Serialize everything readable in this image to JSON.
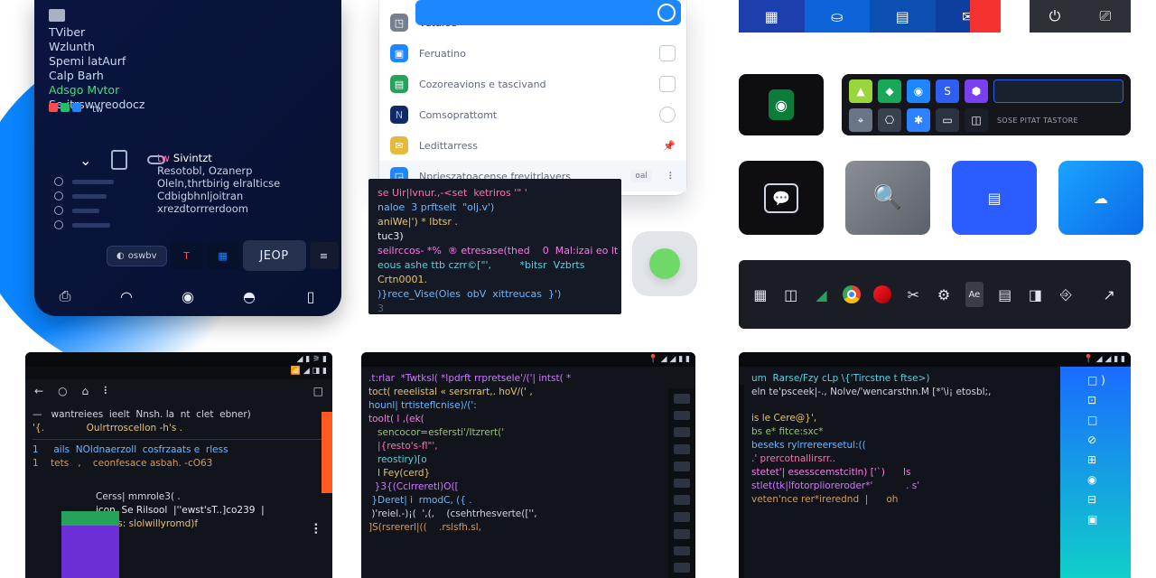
{
  "phone": {
    "links": [
      "TViber",
      "Wzlunth",
      "Spemi latAurf",
      "Calp Barh",
      "Adsgo Mvtor",
      "Se itrswvreodocz"
    ],
    "chips": [
      "#ff4a4a",
      "#21c065",
      "#1d87ff"
    ],
    "side": {
      "tag": "tw",
      "head": "Sivintzt",
      "l2": "Resotobl, Ozanerp",
      "l3": "Oleln,thrtbirig elralticse",
      "l4": "Cdbigbhnljoitran",
      "l5": "xrezdtorrrerdoom"
    },
    "pill": "oswbv",
    "big": "JEOP"
  },
  "dropdown": {
    "items": [
      {
        "c": "#74808f",
        "t": "Vutarse"
      },
      {
        "c": "#1d87ff",
        "t": "Feruatino"
      },
      {
        "c": "#25a35a",
        "t": "Cozoreavions e tascivand"
      },
      {
        "c": "#102a66",
        "t": "Comsoprattomt"
      },
      {
        "c": "#e7b93b",
        "t": "Ledittarress"
      },
      {
        "c": "#1d87ff",
        "t": "Nprieszatoacense frevitrlavers",
        "sel": true,
        "badge": "oal"
      }
    ]
  },
  "code": {
    "l1": "se Uir|lvnur.,-<set  ketriros '\" '",
    "l2": "naloe  3 prftselt  \"olj.v')",
    "l3": "aniWe|') * lbtsr .",
    "l4": "tuc3)",
    "l5": "seilrccos- *%  ® etresase(thed    0  Mal:izai eo lt",
    "l6": "eous ashe ttb czrr©[\"',         *bitsr  Vzbrts",
    "l7": "Crtn0001.",
    "l8": ")}rece_Vise(Oles  obV  xittreucas  }')",
    "l9": "3"
  },
  "tabs": [
    {
      "bg": "#1d3fae",
      "ic": "grid"
    },
    {
      "bg": "#0e63d8",
      "ic": "user"
    },
    {
      "bg": "#0b50b0",
      "ic": "doc"
    },
    {
      "bg": "#0e3fa0",
      "ic": "mail"
    }
  ],
  "grid": {
    "r1": [
      "#9ad63a",
      "#19a85a",
      "#1d87ff",
      "#2e5ff0",
      "#7a3ff0",
      "#18212e"
    ],
    "r2": [
      "#6a7586",
      "#384150",
      "#2d83ff",
      "#2b3240",
      "#1a1f29",
      "#20262f"
    ],
    "label": "SOSE PITAT TASTORE"
  },
  "tiles": [
    {
      "bg": "#0e0e11",
      "ic": "chat"
    },
    {
      "bg": "linear-gradient(135deg,#8a8f97,#5b6069)",
      "ic": "search"
    },
    {
      "bg": "#2a5cff",
      "ic": "lines"
    },
    {
      "bg": "linear-gradient(135deg,#1aa4ff,#0a6ae8)",
      "ic": "cloud"
    }
  ],
  "mob1": {
    "nav": [
      "←",
      "○",
      "⌂",
      "⠇",
      "□"
    ],
    "l1": "—   wantreiees  ieelt  Nnsh. la  nt  clet  ebner)",
    "l2": "'{.              Oulrtrroscellon -h's .",
    "l3": "1     ails  NOldnaerzoll  cosfrzaats e  rless",
    "l4": "1    tets   ,    ceonfesace asbah. -cO63",
    "l5": "Cerss| mmrole3( .",
    "l6": "icon  Se Rilsool  |''ewst'sT..]co239  |",
    "l7": "ffrees: slolwillyromd)f"
  },
  "mob2": {
    "l1": ".t:rlar  *Twtksl( *lpdrft rrpretsele'/('| intst( *",
    "l2": "toct( reeelistal « sersrrart,. hoV/(' ,",
    "l3": "hounl| trtisteflcnise)/(':",
    "l4": "toolt( l ,(ek(",
    "l5": "   sencocor=esfersti'/Itzrert('",
    "l6": "   |{resto's-fl\"',",
    "l7": "   reostiry)[o",
    "l8": "   l Fey(cerd}",
    "l9": "  }3{(Cclrreretl)O([",
    "l10": " }Deret| i  rmodC, ({ .",
    "l11": " )'reiel.-)¡(  ',(,    (csehtrhesverte(['',",
    "l12": "]S(rsrererl|((    .rslsfh.sl,",
    "side_n": 11
  },
  "mob3": {
    "l1": "um  Rarse/Fzy cLp \\{'Tircstne t ftse>)",
    "l2": "eln te'psceek|-., Nolve/'wencarsthn.M [*'\\i¡ etosbl;,",
    "l3": "is le Cere@}',",
    "l4": "bs e* fitce:sxc*",
    "l5": "beseks rylrrereersetul:((",
    "l6": ".' prercotnallirsrr..",
    "l7": "stetet'| esesscemstcitln) ['`)      ls",
    "l8": "stlet(tk|lfotorplioreroder*'           . s'",
    "l9": "veten'nce rer*irerednd  |      oh",
    "rc": [
      "□ )",
      "⊡",
      "□",
      "⊘",
      "⊞",
      "◉",
      "⊟",
      "▣"
    ]
  },
  "taskbar_n": 12
}
